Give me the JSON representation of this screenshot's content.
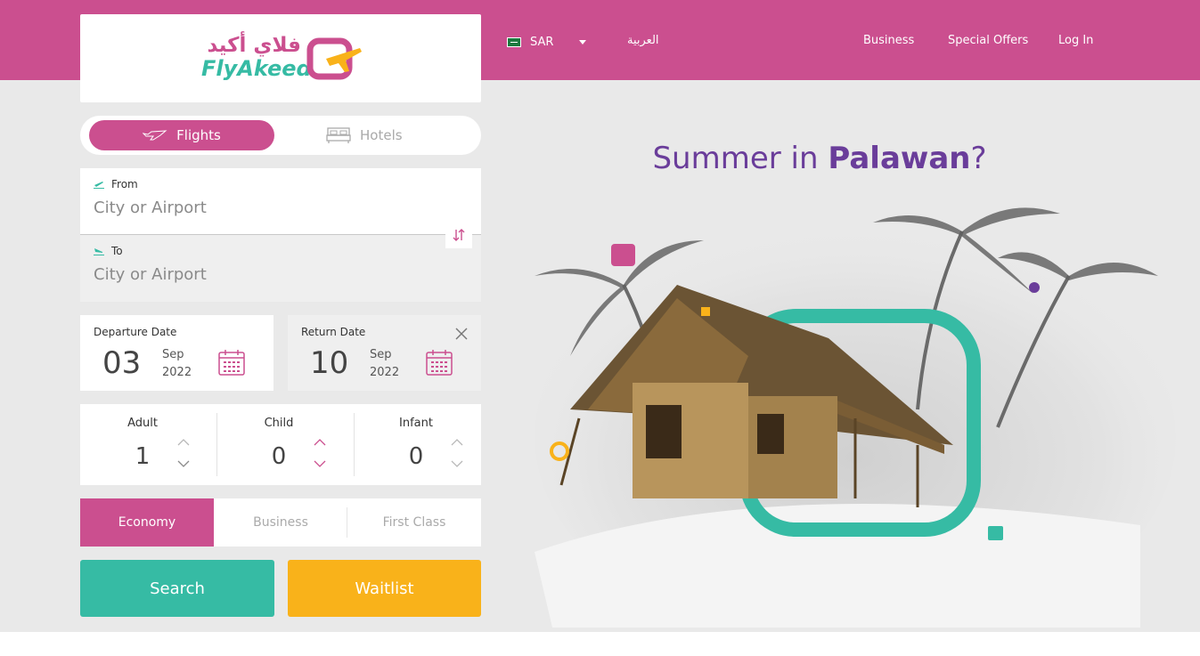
{
  "brand": {
    "name_en": "FlyAkeed",
    "name_ar": "فلاي أكيد"
  },
  "header": {
    "currency": "SAR",
    "language": "العربية",
    "links": [
      "Business",
      "Special Offers",
      "Log In"
    ]
  },
  "tabs": {
    "flights": "Flights",
    "hotels": "Hotels"
  },
  "search": {
    "from_label": "From",
    "from_placeholder": "City or Airport",
    "to_label": "To",
    "to_placeholder": "City or Airport"
  },
  "dates": {
    "departure": {
      "label": "Departure Date",
      "day": "03",
      "month": "Sep",
      "year": "2022"
    },
    "return": {
      "label": "Return Date",
      "day": "10",
      "month": "Sep",
      "year": "2022"
    }
  },
  "passengers": [
    {
      "label": "Adult",
      "value": "1"
    },
    {
      "label": "Child",
      "value": "0"
    },
    {
      "label": "Infant",
      "value": "0"
    }
  ],
  "cabin": {
    "options": [
      "Economy",
      "Business",
      "First Class"
    ],
    "selected": "Economy"
  },
  "buttons": {
    "search": "Search",
    "waitlist": "Waitlist"
  },
  "hero": {
    "title_prefix": "Summer in ",
    "title_emphasis": "Palawan",
    "title_suffix": "?"
  },
  "colors": {
    "brand_pink": "#cb4f8f",
    "teal": "#36bba4",
    "yellow": "#f9b21a",
    "purple": "#6a3d9a"
  },
  "icons": [
    "plane-icon",
    "bed-icon",
    "takeoff-icon",
    "landing-icon",
    "swap-icon",
    "calendar-icon",
    "close-icon",
    "chevron-up-icon",
    "chevron-down-icon",
    "flag-icon",
    "caret-down-icon"
  ]
}
